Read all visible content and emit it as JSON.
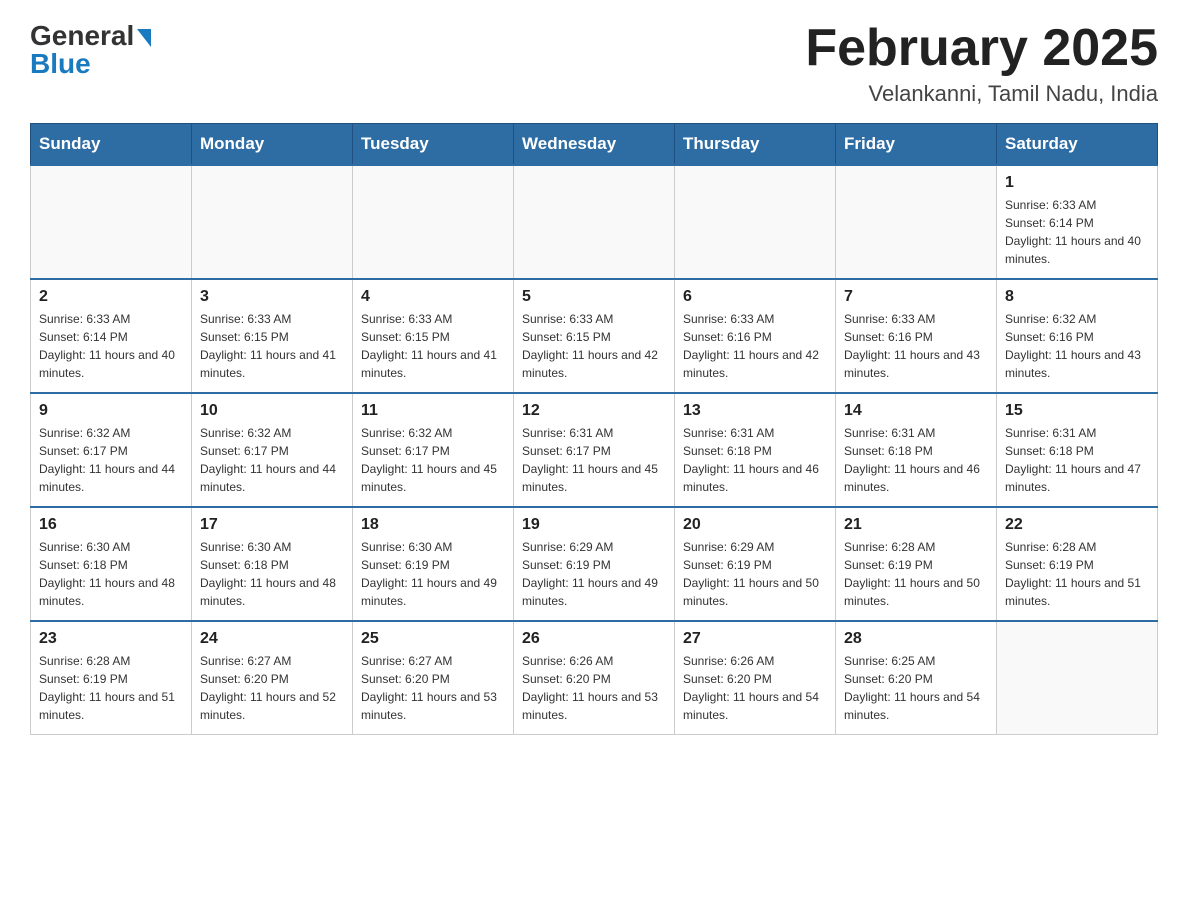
{
  "logo": {
    "general": "General",
    "blue": "Blue"
  },
  "header": {
    "month": "February 2025",
    "location": "Velankanni, Tamil Nadu, India"
  },
  "days_of_week": [
    "Sunday",
    "Monday",
    "Tuesday",
    "Wednesday",
    "Thursday",
    "Friday",
    "Saturday"
  ],
  "weeks": [
    [
      {
        "day": "",
        "info": ""
      },
      {
        "day": "",
        "info": ""
      },
      {
        "day": "",
        "info": ""
      },
      {
        "day": "",
        "info": ""
      },
      {
        "day": "",
        "info": ""
      },
      {
        "day": "",
        "info": ""
      },
      {
        "day": "1",
        "info": "Sunrise: 6:33 AM\nSunset: 6:14 PM\nDaylight: 11 hours and 40 minutes."
      }
    ],
    [
      {
        "day": "2",
        "info": "Sunrise: 6:33 AM\nSunset: 6:14 PM\nDaylight: 11 hours and 40 minutes."
      },
      {
        "day": "3",
        "info": "Sunrise: 6:33 AM\nSunset: 6:15 PM\nDaylight: 11 hours and 41 minutes."
      },
      {
        "day": "4",
        "info": "Sunrise: 6:33 AM\nSunset: 6:15 PM\nDaylight: 11 hours and 41 minutes."
      },
      {
        "day": "5",
        "info": "Sunrise: 6:33 AM\nSunset: 6:15 PM\nDaylight: 11 hours and 42 minutes."
      },
      {
        "day": "6",
        "info": "Sunrise: 6:33 AM\nSunset: 6:16 PM\nDaylight: 11 hours and 42 minutes."
      },
      {
        "day": "7",
        "info": "Sunrise: 6:33 AM\nSunset: 6:16 PM\nDaylight: 11 hours and 43 minutes."
      },
      {
        "day": "8",
        "info": "Sunrise: 6:32 AM\nSunset: 6:16 PM\nDaylight: 11 hours and 43 minutes."
      }
    ],
    [
      {
        "day": "9",
        "info": "Sunrise: 6:32 AM\nSunset: 6:17 PM\nDaylight: 11 hours and 44 minutes."
      },
      {
        "day": "10",
        "info": "Sunrise: 6:32 AM\nSunset: 6:17 PM\nDaylight: 11 hours and 44 minutes."
      },
      {
        "day": "11",
        "info": "Sunrise: 6:32 AM\nSunset: 6:17 PM\nDaylight: 11 hours and 45 minutes."
      },
      {
        "day": "12",
        "info": "Sunrise: 6:31 AM\nSunset: 6:17 PM\nDaylight: 11 hours and 45 minutes."
      },
      {
        "day": "13",
        "info": "Sunrise: 6:31 AM\nSunset: 6:18 PM\nDaylight: 11 hours and 46 minutes."
      },
      {
        "day": "14",
        "info": "Sunrise: 6:31 AM\nSunset: 6:18 PM\nDaylight: 11 hours and 46 minutes."
      },
      {
        "day": "15",
        "info": "Sunrise: 6:31 AM\nSunset: 6:18 PM\nDaylight: 11 hours and 47 minutes."
      }
    ],
    [
      {
        "day": "16",
        "info": "Sunrise: 6:30 AM\nSunset: 6:18 PM\nDaylight: 11 hours and 48 minutes."
      },
      {
        "day": "17",
        "info": "Sunrise: 6:30 AM\nSunset: 6:18 PM\nDaylight: 11 hours and 48 minutes."
      },
      {
        "day": "18",
        "info": "Sunrise: 6:30 AM\nSunset: 6:19 PM\nDaylight: 11 hours and 49 minutes."
      },
      {
        "day": "19",
        "info": "Sunrise: 6:29 AM\nSunset: 6:19 PM\nDaylight: 11 hours and 49 minutes."
      },
      {
        "day": "20",
        "info": "Sunrise: 6:29 AM\nSunset: 6:19 PM\nDaylight: 11 hours and 50 minutes."
      },
      {
        "day": "21",
        "info": "Sunrise: 6:28 AM\nSunset: 6:19 PM\nDaylight: 11 hours and 50 minutes."
      },
      {
        "day": "22",
        "info": "Sunrise: 6:28 AM\nSunset: 6:19 PM\nDaylight: 11 hours and 51 minutes."
      }
    ],
    [
      {
        "day": "23",
        "info": "Sunrise: 6:28 AM\nSunset: 6:19 PM\nDaylight: 11 hours and 51 minutes."
      },
      {
        "day": "24",
        "info": "Sunrise: 6:27 AM\nSunset: 6:20 PM\nDaylight: 11 hours and 52 minutes."
      },
      {
        "day": "25",
        "info": "Sunrise: 6:27 AM\nSunset: 6:20 PM\nDaylight: 11 hours and 53 minutes."
      },
      {
        "day": "26",
        "info": "Sunrise: 6:26 AM\nSunset: 6:20 PM\nDaylight: 11 hours and 53 minutes."
      },
      {
        "day": "27",
        "info": "Sunrise: 6:26 AM\nSunset: 6:20 PM\nDaylight: 11 hours and 54 minutes."
      },
      {
        "day": "28",
        "info": "Sunrise: 6:25 AM\nSunset: 6:20 PM\nDaylight: 11 hours and 54 minutes."
      },
      {
        "day": "",
        "info": ""
      }
    ]
  ]
}
